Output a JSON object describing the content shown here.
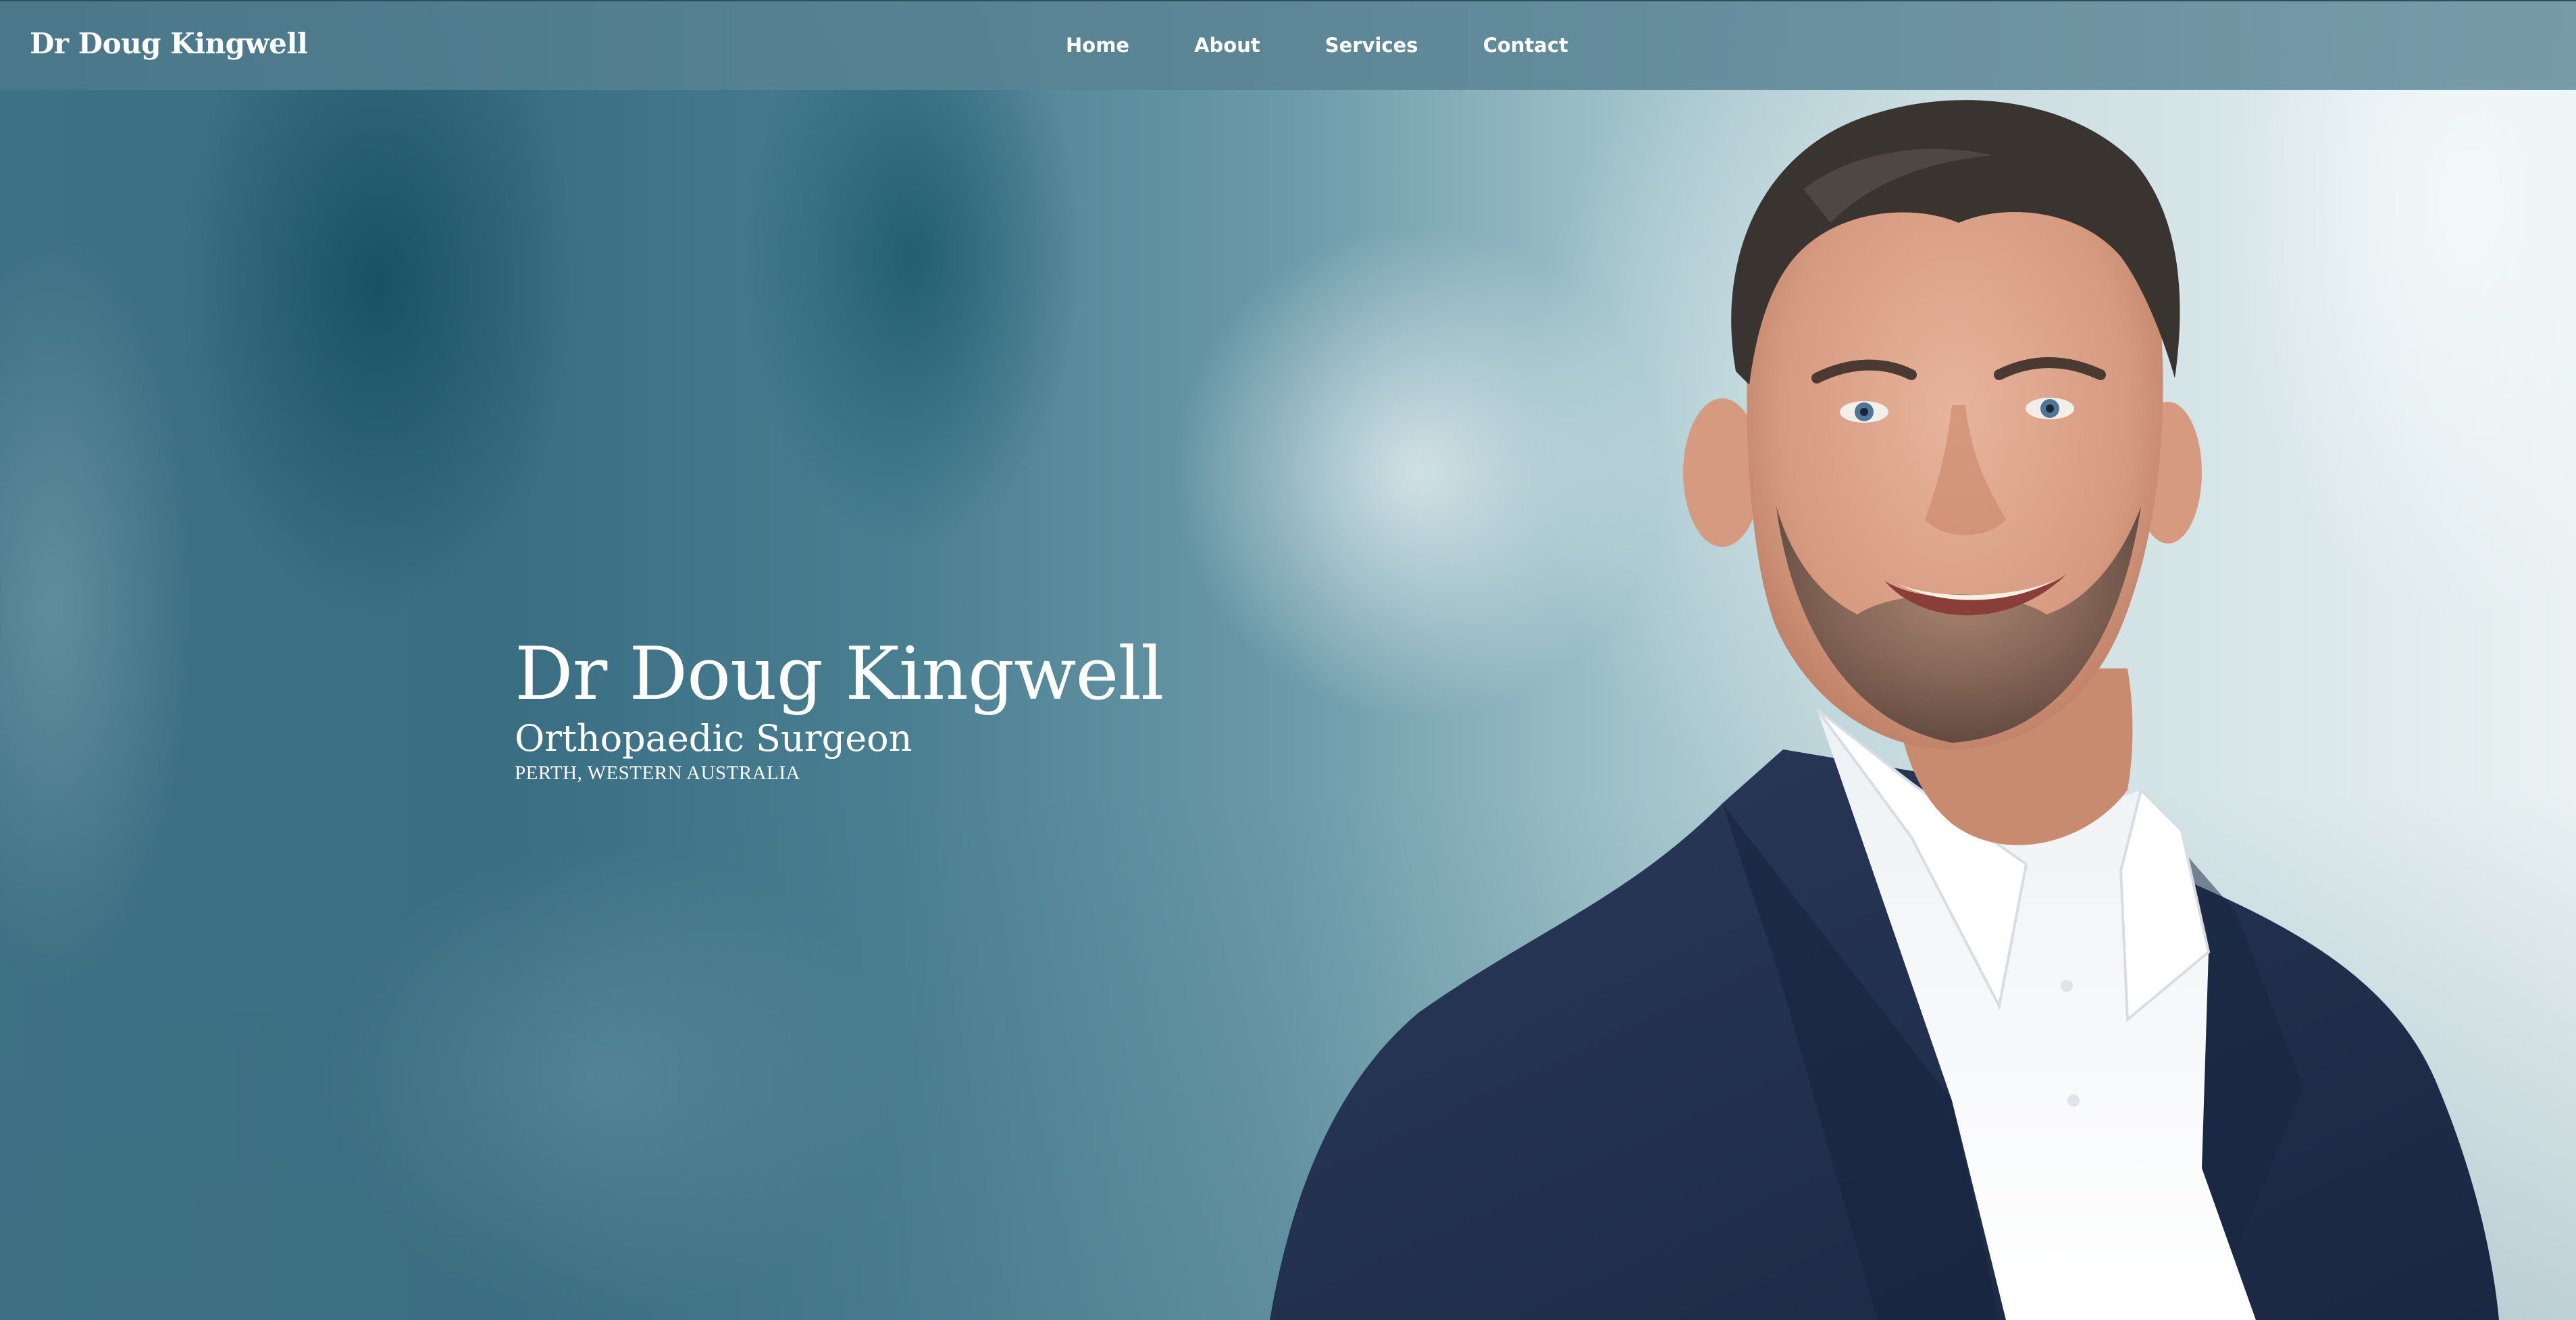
{
  "header": {
    "brand": "Dr Doug Kingwell",
    "nav": [
      {
        "label": "Home"
      },
      {
        "label": "About"
      },
      {
        "label": "Services"
      },
      {
        "label": "Contact"
      }
    ]
  },
  "hero": {
    "title": "Dr Doug Kingwell",
    "subtitle": "Orthopaedic Surgeon",
    "location": "PERTH, WESTERN AUSTRALIA",
    "portrait": "doctor-portrait"
  },
  "colors": {
    "header_bg": "#5a8596",
    "hero_teal": "#3d7185",
    "text": "#ffffff",
    "suit": "#1f2f4d",
    "shirt": "#f4f6f8"
  }
}
